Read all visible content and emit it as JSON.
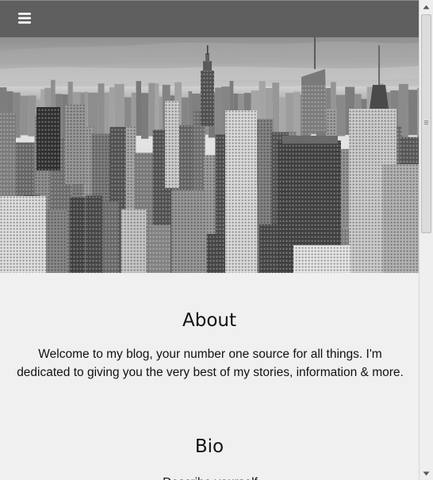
{
  "nav": {
    "menu_icon": "hamburger-menu-icon"
  },
  "hero": {
    "image": "black-and-white-city-skyline-photo"
  },
  "about": {
    "title": "About",
    "text": "Welcome to my blog, your number one source for all things. I'm dedicated to giving you the very best of my stories, information & more."
  },
  "bio": {
    "title": "Bio",
    "text": "Describe yourself"
  },
  "colors": {
    "topbar": "#5f5f5f",
    "page_background": "#f0f0f0",
    "text": "#111111"
  }
}
